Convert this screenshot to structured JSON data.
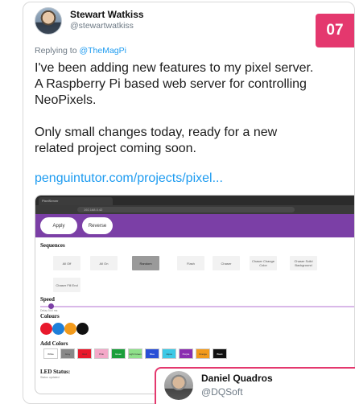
{
  "tweet": {
    "name": "Stewart Watkiss",
    "handle": "@stewartwatkiss",
    "badge": "07",
    "replying_prefix": "Replying to ",
    "replying_mention": "@TheMagPi",
    "paragraph1": "I've been adding new features to my pixel server. A Raspberry Pi based web server for controlling NeoPixels.",
    "paragraph2": "Only small changes today, ready for a new related project coming soon.",
    "link": "penguintutor.com/projects/pixel..."
  },
  "screenshot": {
    "tab_label": "PixelServer",
    "url": "192.168.0.42",
    "apply_label": "Apply",
    "reverse_label": "Reverse",
    "sequences_heading": "Sequences",
    "sequences": [
      "All Off",
      "All On",
      "Random",
      "Flash",
      "Chaser",
      "Chaser Change Color",
      "Chaser Solid Background",
      "Chaser Fill End"
    ],
    "active_sequence": "Random",
    "speed_heading": "Speed",
    "speed_note": "Delay 500 ms",
    "colours_heading": "Colours",
    "colours": [
      "#e8192c",
      "#1e7fd9",
      "#f29a1b",
      "#111111"
    ],
    "add_colours_heading": "Add Colors",
    "swatches": [
      {
        "label": "White",
        "color": "#ffffff"
      },
      {
        "label": "Grey",
        "color": "#888888"
      },
      {
        "label": "Red",
        "color": "#e8192c"
      },
      {
        "label": "Pink",
        "color": "#f4a8c8"
      },
      {
        "label": "Green",
        "color": "#1a9e3a"
      },
      {
        "label": "Light Green",
        "color": "#8fe08a"
      },
      {
        "label": "Blue",
        "color": "#2a4fd6"
      },
      {
        "label": "Aqua",
        "color": "#3ec9e6"
      },
      {
        "label": "Purple",
        "color": "#8a2fb0"
      },
      {
        "label": "Orange",
        "color": "#f29a1b"
      },
      {
        "label": "Black",
        "color": "#111111"
      }
    ],
    "led_status_heading": "LED Status:",
    "led_status_note": "Status updated"
  },
  "tweet2": {
    "name": "Daniel Quadros",
    "handle": "@DQSoft"
  },
  "colors": {
    "accent_pink": "#e4386e",
    "link_blue": "#1d9bf0",
    "app_purple": "#7b3fa6"
  }
}
